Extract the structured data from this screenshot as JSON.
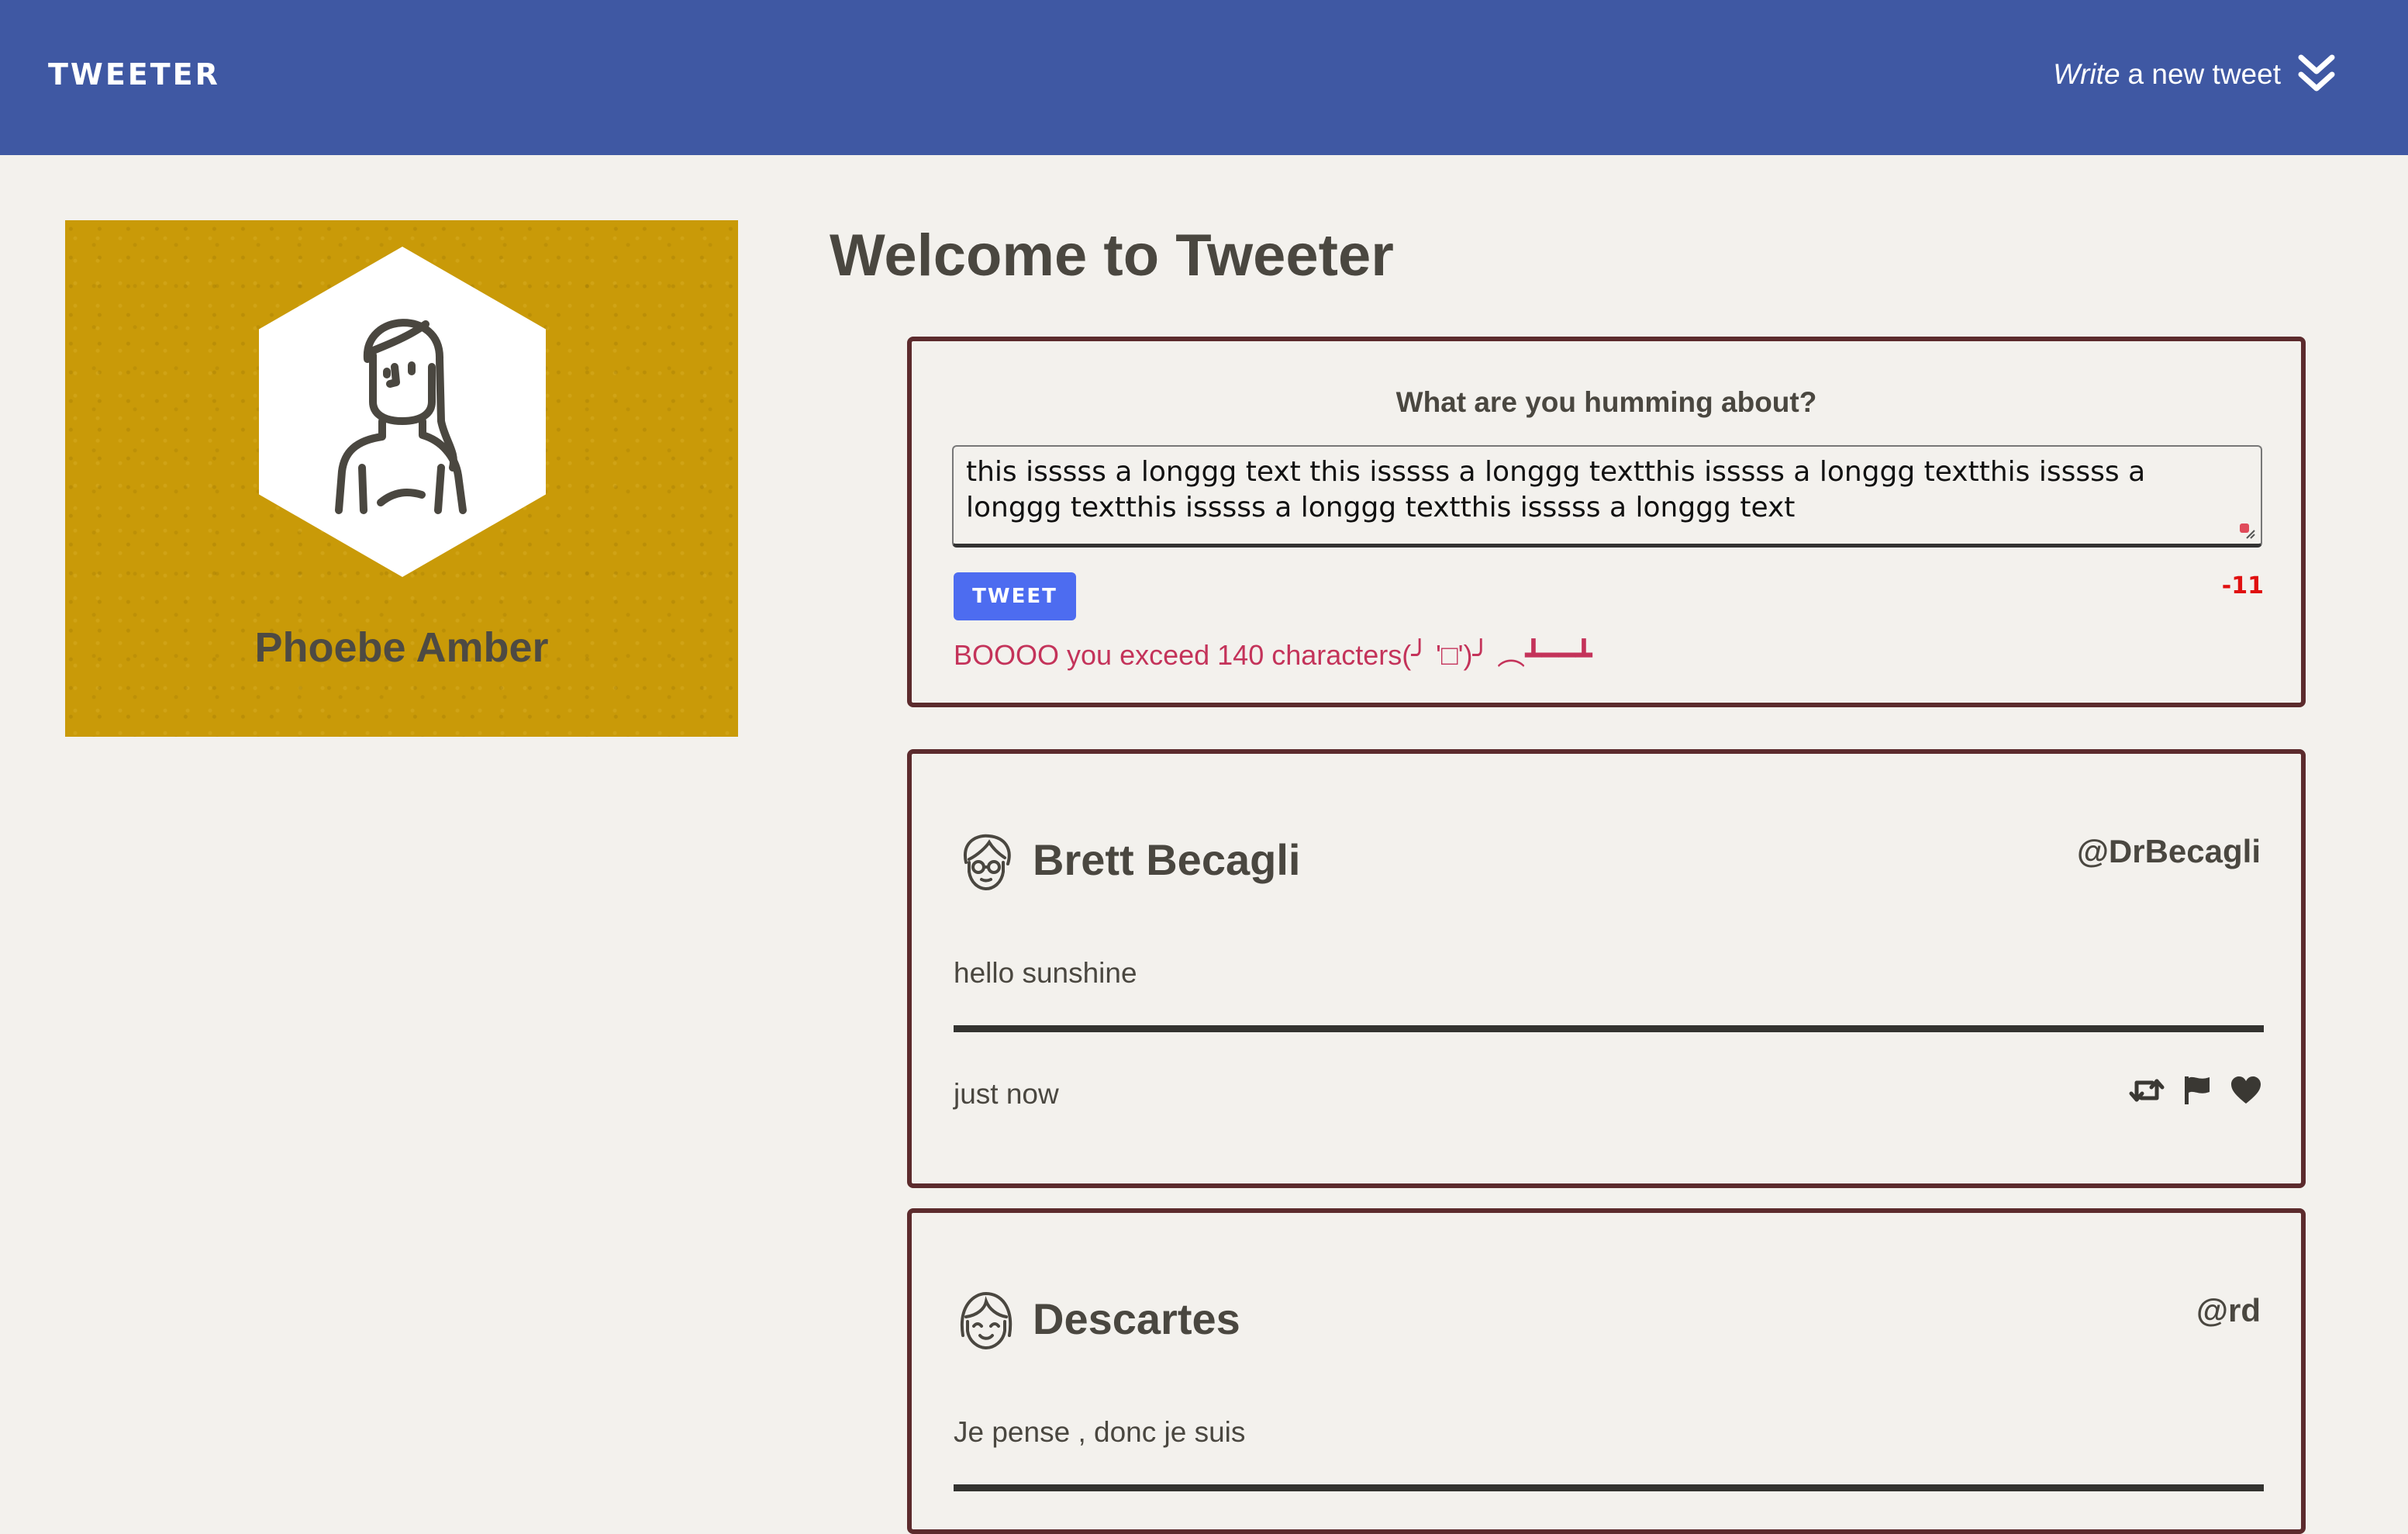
{
  "header": {
    "brand": "TWEETER",
    "compose_toggle_em": "Write",
    "compose_toggle_rest": "a new tweet",
    "compose_toggle_icon": "double-chevron-down-icon"
  },
  "profile": {
    "name": "Phoebe Amber",
    "avatar_icon": "woman-avatar-icon",
    "card_color": "#c99a08"
  },
  "main": {
    "title": "Welcome to Tweeter"
  },
  "composer": {
    "label": "What are you humming about?",
    "textarea_value": "this isssss a longgg text this isssss a longgg textthis isssss a longgg textthis isssss a longgg textthis isssss a longgg textthis isssss a longgg text",
    "button_label": "TWEET",
    "counter": "-11",
    "error": "BOOOO you exceed 140 characters(╯ '□')╯ ︵┻━━┻"
  },
  "tweets": [
    {
      "name": "Brett Becagli",
      "handle": "@DrBecagli",
      "avatar_icon": "man-glasses-avatar-icon",
      "text": "hello sunshine",
      "time": "just now",
      "actions": [
        "retweet-icon",
        "flag-icon",
        "heart-icon"
      ]
    },
    {
      "name": "Descartes",
      "handle": "@rd",
      "avatar_icon": "smiling-face-avatar-icon",
      "text": "Je pense , donc je suis"
    }
  ],
  "colors": {
    "header": "#3f58a3",
    "page_bg": "#f3f1ed",
    "card_border": "#5c2b2d",
    "button": "#4d6cf0",
    "error": "#c4335a",
    "counter": "#e01010"
  }
}
